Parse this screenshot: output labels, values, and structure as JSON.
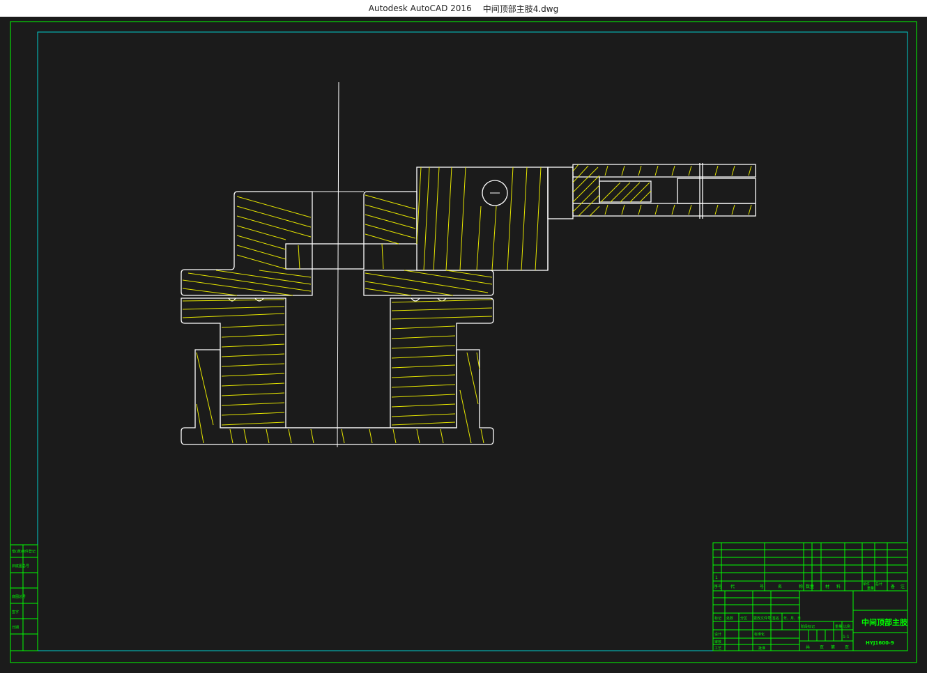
{
  "window": {
    "app_title": "Autodesk AutoCAD 2016",
    "file_name": "中间顶部主肢4.dwg"
  },
  "colors": {
    "background": "#1b1b1b",
    "outline": "#ffffff",
    "hatch": "#ffff00",
    "frame": "#00ff00",
    "border": "#00ffff"
  },
  "title_block": {
    "part_name": "中间顶部主肢",
    "drawing_number": "HYJ1600-9",
    "scale": "1:1",
    "header_labels": [
      "序号",
      "代",
      "号",
      "名",
      "称",
      "数量",
      "材",
      "料",
      "单件",
      "总计",
      "重量",
      "备",
      "注"
    ],
    "row_number": "1",
    "revision_labels": [
      "标记",
      "处数",
      "分区",
      "更改文件号",
      "签名",
      "年、月、日"
    ],
    "sign_labels": [
      "设计",
      "标准化",
      "审核",
      "工艺",
      "批准"
    ],
    "stage_labels": [
      "阶段标记",
      "重量",
      "比例",
      "共",
      "页",
      "第",
      "页"
    ]
  },
  "side_table": {
    "labels": [
      "借(通)用件登记",
      "旧底图总号",
      "底图总号",
      "签字",
      "日期"
    ]
  }
}
